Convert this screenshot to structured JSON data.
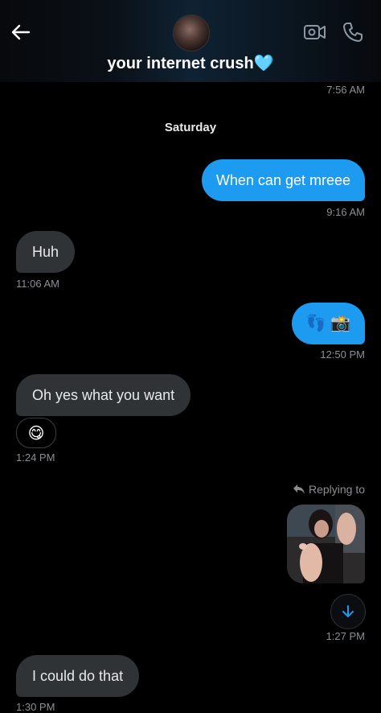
{
  "header": {
    "contact_name": "your internet crush🩵",
    "avatar_icon": "contact-avatar",
    "back_icon": "arrow-left-icon",
    "video_icon": "video-call-icon",
    "call_icon": "phone-icon"
  },
  "messages": {
    "ts_top": "7:56 AM",
    "day_separator": "Saturday",
    "m1_text": "When can get mreee",
    "m1_time": "9:16 AM",
    "m2_text": "Huh",
    "m2_time": "11:06 AM",
    "m3_text": "👣 📸",
    "m3_time": "12:50 PM",
    "m4_text": "Oh yes what you want",
    "m4_reaction": "😋",
    "m4_time": "1:24 PM",
    "reply_label": "Replying to",
    "m5_time": "1:27 PM",
    "m6_text": "I could do that",
    "m6_time": "1:30 PM"
  },
  "colors": {
    "outgoing_bubble": "#1d9bf0",
    "incoming_bubble": "#2f3336",
    "background": "#000000"
  }
}
